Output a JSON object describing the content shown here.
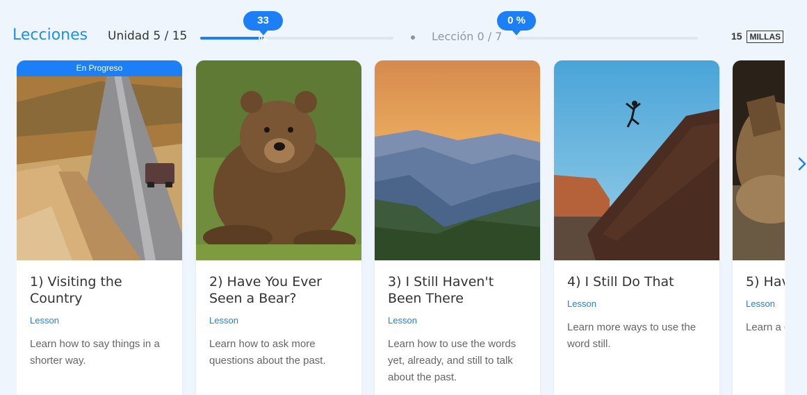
{
  "header": {
    "title": "Lecciones",
    "unit_label": "Unidad 5 / 15",
    "unit_progress_text": "33 %",
    "unit_progress": 0.33,
    "lesson_label": "Lección 0 / 7",
    "lesson_progress_text": "0 %",
    "lesson_progress": 0,
    "miles_value": "15",
    "miles_unit": "MILLAS"
  },
  "colors": {
    "accent": "#1d7ff5",
    "background": "#eef5fd",
    "title_blue": "#1f8ef1"
  },
  "cards": [
    {
      "badge": "En Progreso",
      "title": "1) Visiting the Country",
      "type": "Lesson",
      "description": "Learn how to say things in a shorter way.",
      "image": "country-road-image"
    },
    {
      "title": "2) Have You Ever Seen a Bear?",
      "type": "Lesson",
      "description": "Learn how to ask more questions about the past.",
      "image": "bear-image"
    },
    {
      "title": "3) I Still Haven't Been There",
      "type": "Lesson",
      "description": "Learn how to use the words yet, already, and still to talk about the past.",
      "image": "mountains-image"
    },
    {
      "title": "4) I Still Do That",
      "type": "Lesson",
      "description": "Learn more ways to use the word still.",
      "image": "cliff-jump-image"
    },
    {
      "title": "5) Hav",
      "type": "Lesson",
      "description": "Learn a questio",
      "image": "boot-image"
    }
  ],
  "navigation": {
    "next_icon": "chevron-right-icon"
  }
}
